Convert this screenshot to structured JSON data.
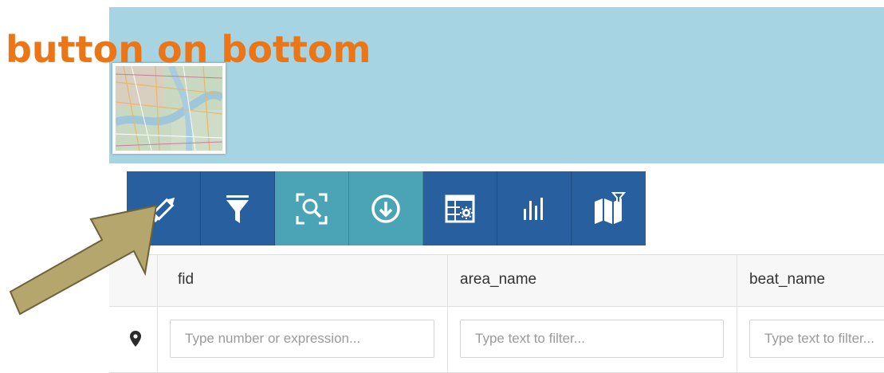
{
  "caption": {
    "text": "button on bottom"
  },
  "toolbar": {
    "buttons": [
      {
        "icon": "pencil-icon",
        "group": "dark"
      },
      {
        "icon": "filter-icon",
        "group": "dark"
      },
      {
        "icon": "zoom-to-selection-icon",
        "group": "teal"
      },
      {
        "icon": "download-icon",
        "group": "teal"
      },
      {
        "icon": "table-settings-icon",
        "group": "dark"
      },
      {
        "icon": "bar-chart-icon",
        "group": "dark"
      },
      {
        "icon": "map-filter-icon",
        "group": "dark"
      }
    ]
  },
  "table": {
    "columns": [
      {
        "header": "fid",
        "placeholder": "Type number or expression..."
      },
      {
        "header": "area_name",
        "placeholder": "Type text to filter..."
      },
      {
        "header": "beat_name",
        "placeholder": "Type text to filter..."
      }
    ],
    "row_icon": "map-marker-icon"
  },
  "colors": {
    "header_band": "#a7d4e2",
    "toolbar_dark": "#275f9f",
    "toolbar_teal": "#4ba4b6",
    "caption": "#ec7516",
    "arrow_fill": "#b5a66e"
  }
}
